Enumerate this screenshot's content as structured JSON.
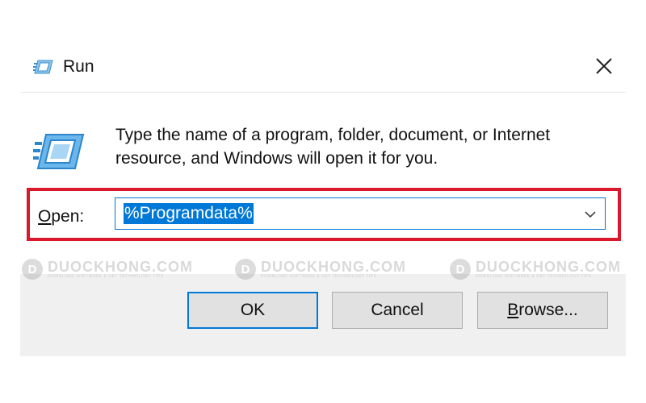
{
  "window": {
    "title": "Run",
    "close_icon": "close-icon",
    "title_icon": "run-app-icon"
  },
  "content": {
    "icon": "run-app-icon",
    "description": "Type the name of a program, folder, document, or Internet resource, and Windows will open it for you.",
    "open_label_accel": "O",
    "open_label_rest": "pen:",
    "open_value": "%Programdata%",
    "dropdown_icon": "chevron-down-icon",
    "highlight_color": "#d9182b"
  },
  "watermark": {
    "logo_letter": "D",
    "text": "DUOCKHONG.COM",
    "subtext": "DOWNLOAD SOFTWARE & GET TECHNOLOGY TIPS"
  },
  "buttons": {
    "ok": "OK",
    "cancel": "Cancel",
    "browse_accel": "B",
    "browse_rest": "rowse..."
  },
  "colors": {
    "accent": "#0078d7",
    "button_bg": "#e1e1e1",
    "footer_bg": "#f0f0f0"
  }
}
